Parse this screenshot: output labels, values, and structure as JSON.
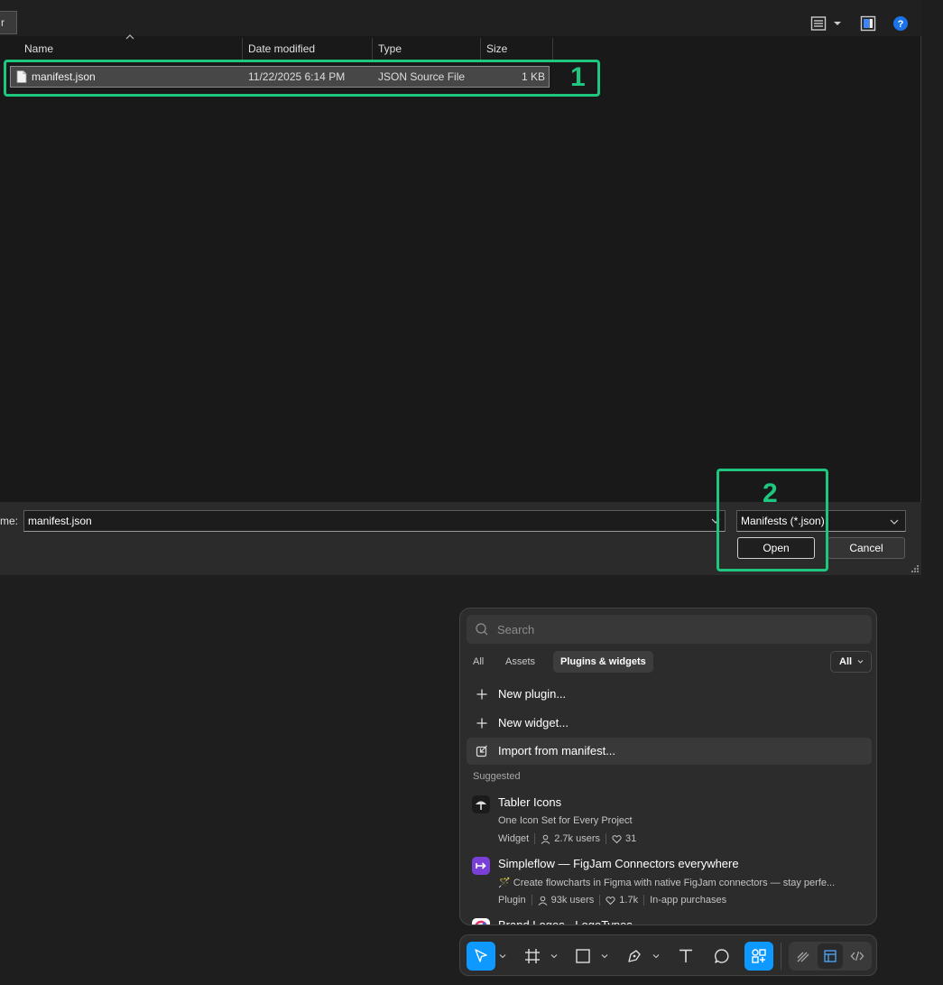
{
  "file_dialog": {
    "breadcrumb_button": "r",
    "columns": {
      "name": "Name",
      "date": "Date modified",
      "type": "Type",
      "size": "Size"
    },
    "files": [
      {
        "name": "manifest.json",
        "date": "11/22/2025 6:14 PM",
        "type": "JSON Source File",
        "size": "1 KB"
      }
    ],
    "file_name_label": "me:",
    "file_name_value": "manifest.json",
    "file_type_filter": "Manifests (*.json)",
    "open_label": "Open",
    "cancel_label": "Cancel"
  },
  "annotations": {
    "first": "1",
    "second": "2",
    "color": "#1fc77e"
  },
  "plugin_panel": {
    "search_placeholder": "Search",
    "tabs": [
      "All",
      "Assets",
      "Plugins & widgets"
    ],
    "active_tab": "Plugins & widgets",
    "filter_label": "All",
    "actions": [
      "New plugin...",
      "New widget...",
      "Import from manifest..."
    ],
    "suggested_label": "Suggested",
    "suggested": [
      {
        "name": "Tabler Icons",
        "description": "One Icon Set for Every Project",
        "kind": "Widget",
        "users": "2.7k users",
        "likes": "31"
      },
      {
        "name": "Simpleflow — FigJam Connectors everywhere",
        "description": "🪄 Create flowcharts in Figma with native FigJam connectors — stay perfe...",
        "kind": "Plugin",
        "users": "93k users",
        "likes": "1.7k",
        "extra": "In-app purchases"
      },
      {
        "name": "Brand Logos - LogoTypes"
      }
    ]
  },
  "toolbar": {
    "accent": "#0d99ff",
    "tools": [
      "move-icon",
      "frame-icon",
      "rectangle-icon",
      "pen-icon",
      "text-icon",
      "comment-icon",
      "plugins-icon"
    ],
    "modes": [
      "draw-icon",
      "design-icon",
      "dev-icon"
    ]
  }
}
